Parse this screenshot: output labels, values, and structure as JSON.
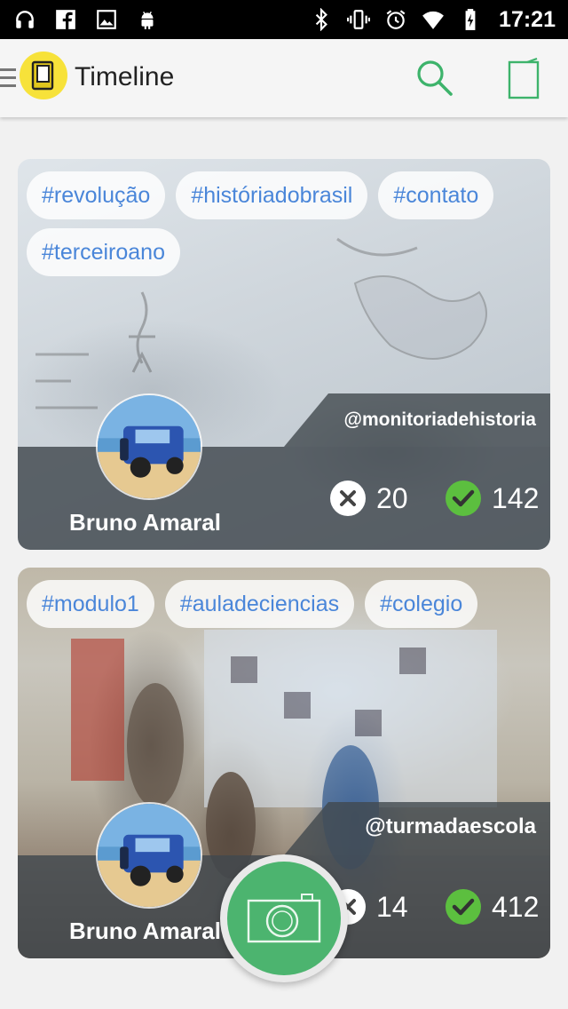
{
  "status_bar": {
    "time": "17:21",
    "icons_left": [
      "headset-icon",
      "facebook-icon",
      "image-icon",
      "android-icon"
    ],
    "icons_right": [
      "bluetooth-icon",
      "vibrate-icon",
      "alarm-icon",
      "wifi-icon",
      "battery-charging-icon"
    ]
  },
  "app_bar": {
    "title": "Timeline",
    "accent_color": "#3db36b",
    "logo_color": "#f7e23a"
  },
  "posts": [
    {
      "tags": [
        "#revolução",
        "#históriadobrasil",
        "#contato",
        "#terceiroano"
      ],
      "handle": "@monitoriadehistoria",
      "author": "Bruno Amaral",
      "rejects": "20",
      "approvals": "142"
    },
    {
      "tags": [
        "#modulo1",
        "#auladeciencias",
        "#colegio"
      ],
      "handle": "@turmadaescola",
      "author": "Bruno Amaral",
      "rejects": "14",
      "approvals": "412"
    }
  ],
  "fab": {
    "icon": "camera-icon",
    "color": "#4cb46f"
  }
}
